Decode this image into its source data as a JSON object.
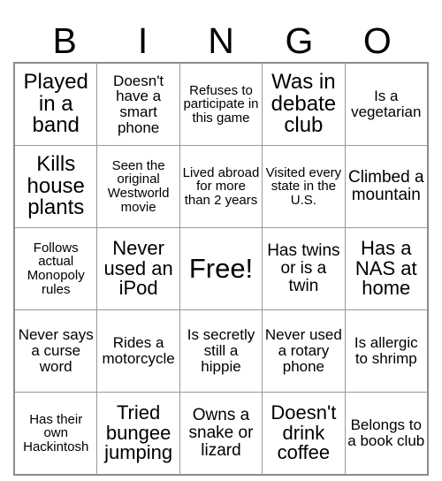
{
  "card": {
    "headers": [
      "B",
      "I",
      "N",
      "G",
      "O"
    ],
    "rows": [
      [
        {
          "text": "Played in a band",
          "size": "fs-xxl"
        },
        {
          "text": "Doesn't have a smart phone",
          "size": "fs-m"
        },
        {
          "text": "Refuses to participate in this game",
          "size": "fs-s"
        },
        {
          "text": "Was in debate club",
          "size": "fs-xxl"
        },
        {
          "text": "Is a vegetarian",
          "size": "fs-m"
        }
      ],
      [
        {
          "text": "Kills house plants",
          "size": "fs-xxl"
        },
        {
          "text": "Seen the original Westworld movie",
          "size": "fs-s"
        },
        {
          "text": "Lived abroad for more than 2 years",
          "size": "fs-s"
        },
        {
          "text": "Visited every state in the U.S.",
          "size": "fs-s"
        },
        {
          "text": "Climbed a mountain",
          "size": "fs-l"
        }
      ],
      [
        {
          "text": "Follows actual Monopoly rules",
          "size": "fs-s"
        },
        {
          "text": "Never used an iPod",
          "size": "fs-xl"
        },
        {
          "text": "Free!",
          "size": "fs-free"
        },
        {
          "text": "Has twins or is a twin",
          "size": "fs-l"
        },
        {
          "text": "Has a NAS at home",
          "size": "fs-xl"
        }
      ],
      [
        {
          "text": "Never says a curse word",
          "size": "fs-m"
        },
        {
          "text": "Rides a motorcycle",
          "size": "fs-m"
        },
        {
          "text": "Is secretly still a hippie",
          "size": "fs-m"
        },
        {
          "text": "Never used a rotary phone",
          "size": "fs-m"
        },
        {
          "text": "Is allergic to shrimp",
          "size": "fs-m"
        }
      ],
      [
        {
          "text": "Has their own Hackintosh",
          "size": "fs-s"
        },
        {
          "text": "Tried bungee jumping",
          "size": "fs-xl"
        },
        {
          "text": "Owns a snake or lizard",
          "size": "fs-l"
        },
        {
          "text": "Doesn't drink coffee",
          "size": "fs-xl"
        },
        {
          "text": "Belongs to a book club",
          "size": "fs-m"
        }
      ]
    ]
  }
}
